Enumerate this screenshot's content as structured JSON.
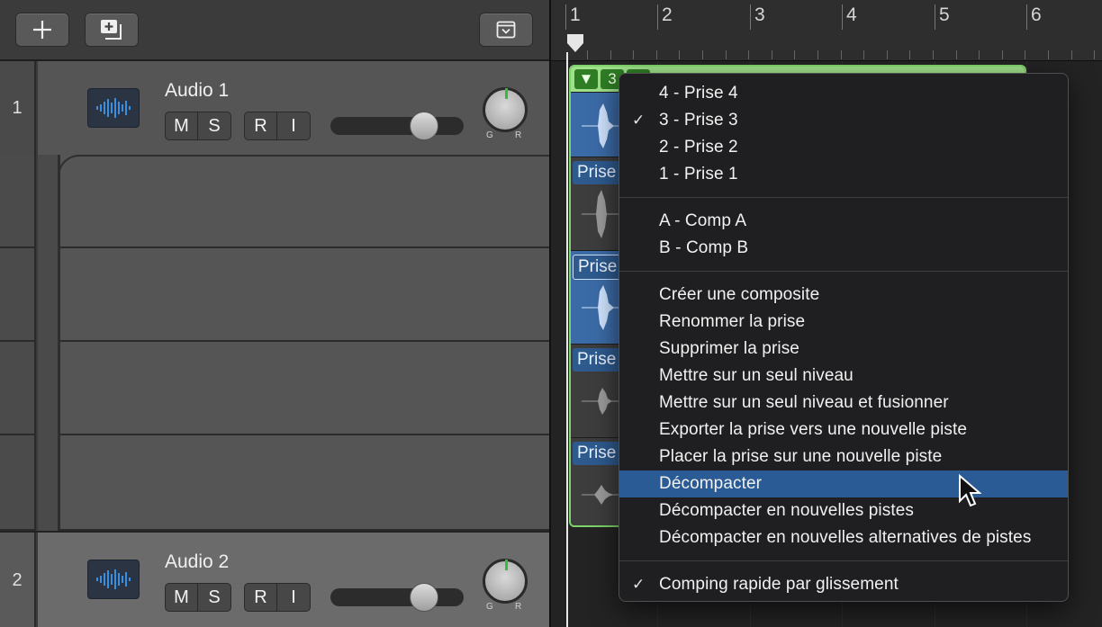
{
  "tracks": [
    {
      "number": "1",
      "name": "Audio 1",
      "buttons": [
        "M",
        "S",
        "R",
        "I"
      ],
      "knob_labels": [
        "G",
        "R"
      ]
    },
    {
      "number": "2",
      "name": "Audio 2",
      "buttons": [
        "M",
        "S",
        "R",
        "I"
      ],
      "knob_labels": [
        "G",
        "R"
      ]
    }
  ],
  "ruler": {
    "bars": [
      "1",
      "2",
      "3",
      "4",
      "5",
      "6"
    ]
  },
  "region": {
    "header_number": "3",
    "takes": [
      {
        "label": "Prise"
      },
      {
        "label": "Prise"
      },
      {
        "label": "Prise"
      },
      {
        "label": "Prise"
      }
    ]
  },
  "menu": {
    "takes": [
      {
        "label": "4 - Prise 4",
        "checked": false
      },
      {
        "label": "3 - Prise 3",
        "checked": true
      },
      {
        "label": "2 - Prise 2",
        "checked": false
      },
      {
        "label": "1 - Prise 1",
        "checked": false
      }
    ],
    "comps": [
      {
        "label": "A - Comp A"
      },
      {
        "label": "B - Comp B"
      }
    ],
    "actions": [
      {
        "label": "Créer une composite"
      },
      {
        "label": "Renommer la prise"
      },
      {
        "label": "Supprimer la prise"
      },
      {
        "label": "Mettre sur un seul niveau"
      },
      {
        "label": "Mettre sur un seul niveau et fusionner"
      },
      {
        "label": "Exporter la prise vers une nouvelle piste"
      },
      {
        "label": "Placer la prise sur une nouvelle piste"
      },
      {
        "label": "Décompacter",
        "highlighted": true
      },
      {
        "label": "Décompacter en nouvelles pistes"
      },
      {
        "label": "Décompacter en nouvelles alternatives de pistes"
      }
    ],
    "quick_swipe": {
      "label": "Comping rapide par glissement",
      "checked": true
    }
  },
  "colors": {
    "region_accent": "#7ed46a",
    "highlight": "#2b5b94",
    "take_active": "#3b6ba6",
    "icon_blue": "#3a8fe0"
  }
}
